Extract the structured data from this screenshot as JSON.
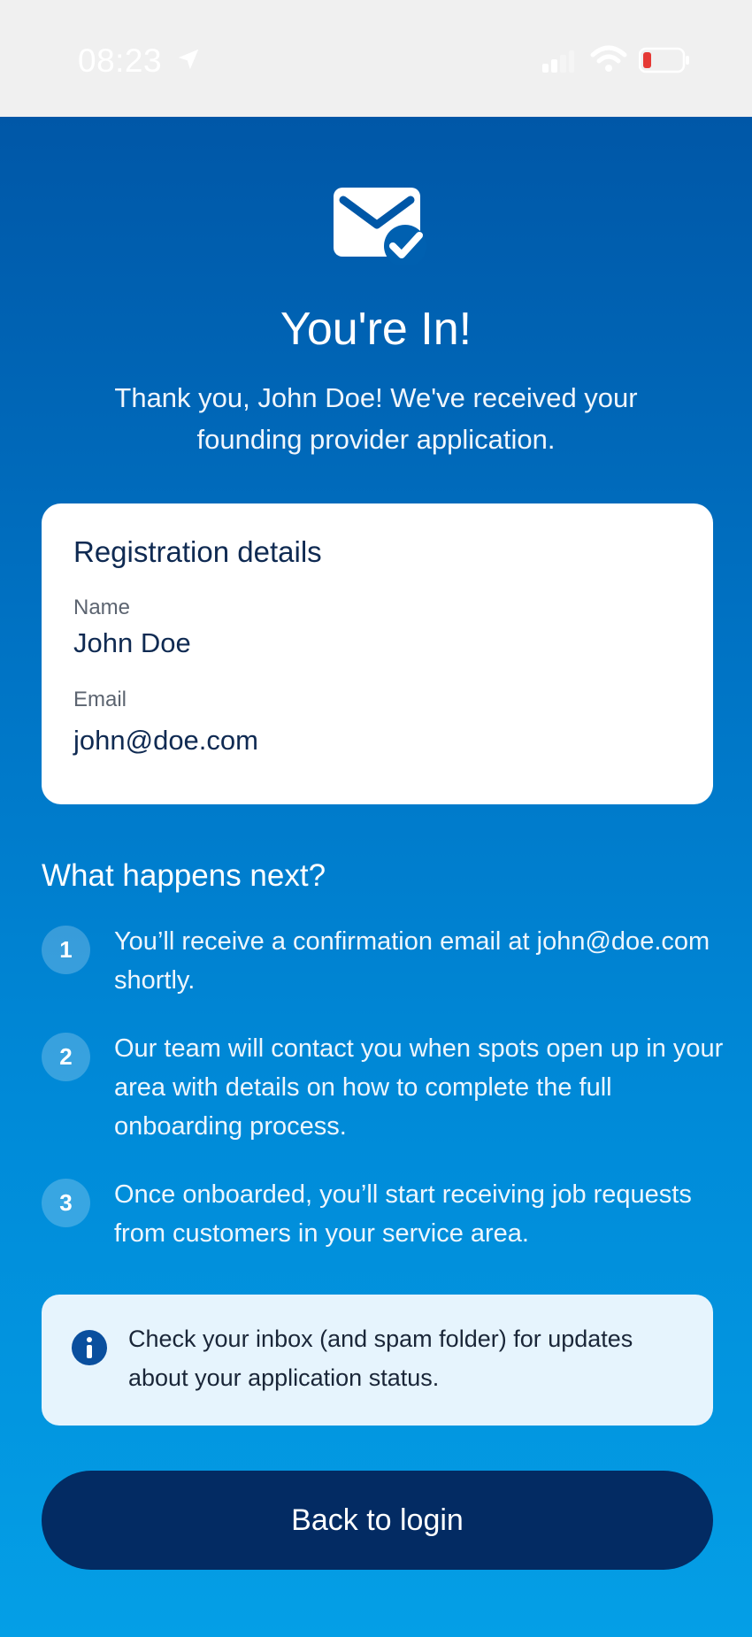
{
  "status_bar": {
    "time": "08:23"
  },
  "header": {
    "title": "You're In!",
    "subtitle": "Thank you, John Doe! We've received your founding provider application."
  },
  "registration": {
    "heading": "Registration details",
    "name_label": "Name",
    "name_value": "John Doe",
    "email_label": "Email",
    "email_value": "john@doe.com"
  },
  "next_steps": {
    "heading": "What happens next?",
    "steps": [
      {
        "number": "1",
        "text": "You’ll receive a confirmation email at john@doe.com shortly."
      },
      {
        "number": "2",
        "text": "Our team will contact you when spots open up in your area with details on how to complete the full onboarding process."
      },
      {
        "number": "3",
        "text": "Once onboarded, you’ll start receiving job requests from customers in your service area."
      }
    ]
  },
  "info": {
    "text": "Check your inbox (and spam folder) for updates about your application status."
  },
  "actions": {
    "back_label": "Back to login"
  },
  "colors": {
    "primary_dark": "#032b63",
    "gradient_top": "#0057a7",
    "gradient_bottom": "#049fe6",
    "battery_low": "#e53935"
  },
  "icons": [
    "location-arrow-icon",
    "signal-icon",
    "wifi-icon",
    "battery-icon",
    "mail-check-icon",
    "info-icon"
  ]
}
